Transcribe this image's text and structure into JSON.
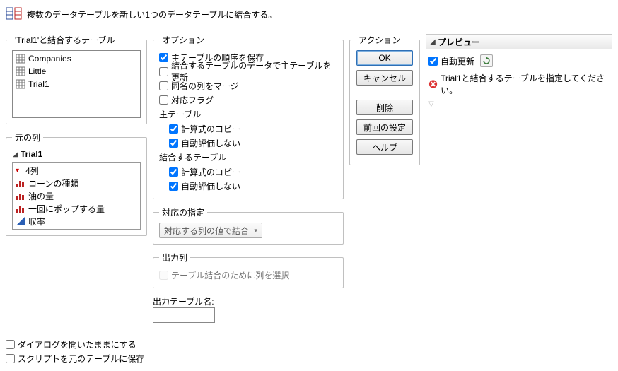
{
  "header": {
    "title": "複数のデータテーブルを新しい1つのデータテーブルに結合する。"
  },
  "join_tables": {
    "legend": "'Trial1'と結合するテーブル",
    "items": [
      "Companies",
      "Little",
      "Trial1"
    ]
  },
  "source_cols": {
    "legend": "元の列",
    "table": "Trial1",
    "count_label": "4列",
    "columns": [
      {
        "name": "コーンの種類",
        "type": "nominal"
      },
      {
        "name": "油の量",
        "type": "nominal"
      },
      {
        "name": "一回にポップする量",
        "type": "nominal"
      },
      {
        "name": "収率",
        "type": "continuous"
      }
    ]
  },
  "options": {
    "legend": "オプション",
    "preserve_order": "主テーブルの順序を保存",
    "update_main": "結合するテーブルのデータで主テーブルを更新",
    "merge_same": "同名の列をマージ",
    "match_flag": "対応フラグ",
    "main_table_label": "主テーブル",
    "copy_formula_main": "計算式のコピー",
    "suppress_eval_main": "自動評価しない",
    "join_table_label": "結合するテーブル",
    "copy_formula_join": "計算式のコピー",
    "suppress_eval_join": "自動評価しない"
  },
  "match_spec": {
    "legend": "対応の指定",
    "selected": "対応する列の値で結合"
  },
  "output_cols": {
    "legend": "出力列",
    "checkbox": "テーブル結合のために列を選択"
  },
  "output_name": {
    "label": "出力テーブル名:",
    "value": ""
  },
  "actions": {
    "legend": "アクション",
    "ok": "OK",
    "cancel": "キャンセル",
    "remove": "削除",
    "recall": "前回の設定",
    "help": "ヘルプ"
  },
  "preview": {
    "title": "プレビュー",
    "auto_update": "自動更新",
    "error": "Trial1と結合するテーブルを指定してください。"
  },
  "footer": {
    "keep_open": "ダイアログを開いたままにする",
    "save_script": "スクリプトを元のテーブルに保存"
  }
}
